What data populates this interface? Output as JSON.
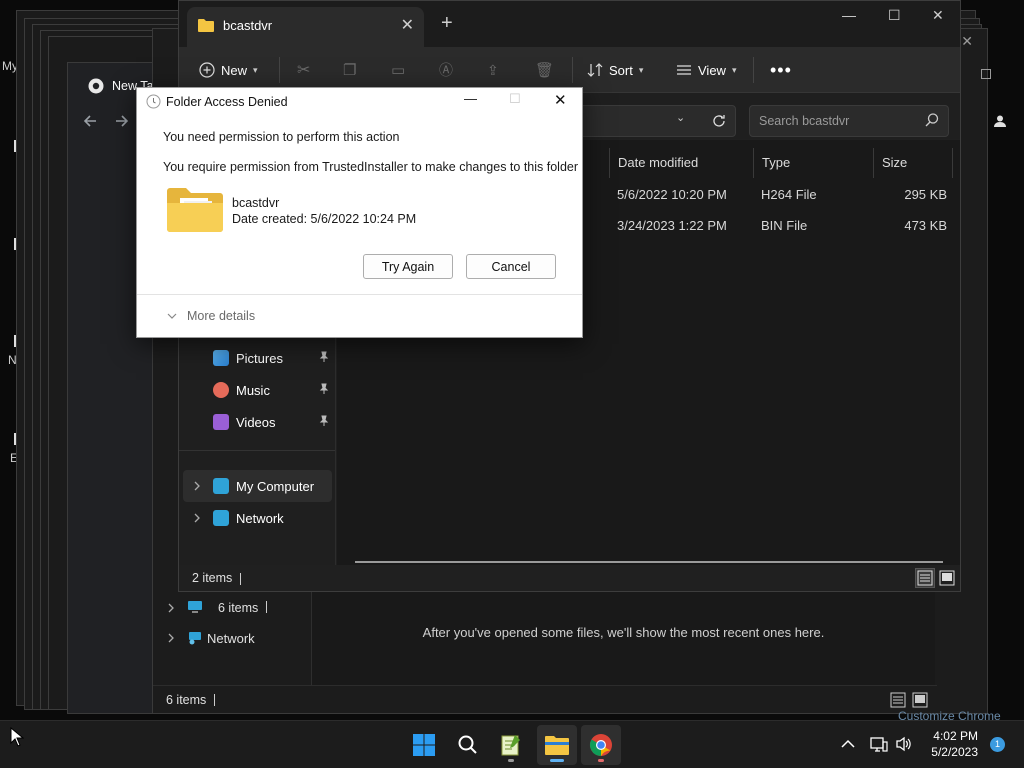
{
  "desktop": {
    "frag_1": "My",
    "frag_2": "N",
    "frag_3": "E"
  },
  "chrome": {
    "tab_title": "New Tab",
    "partial_text": "Customize Chrome"
  },
  "back_explorer": {
    "nav": {
      "my_computer_count_label": "6 items",
      "network_label": "Network"
    },
    "empty_message": "After you've opened some files, we'll show the most recent ones here.",
    "status": "6 items"
  },
  "explorer": {
    "tab_title": "bcastdvr",
    "toolbar": {
      "new_label": "New",
      "sort_label": "Sort",
      "view_label": "View"
    },
    "search_placeholder": "Search bcastdvr",
    "columns": {
      "date": "Date modified",
      "type": "Type",
      "size": "Size"
    },
    "files": [
      {
        "date": "5/6/2022 10:20 PM",
        "type": "H264 File",
        "size": "295 KB"
      },
      {
        "date": "3/24/2023 1:22 PM",
        "type": "BIN File",
        "size": "473 KB"
      }
    ],
    "nav": {
      "pictures": "Pictures",
      "music": "Music",
      "videos": "Videos",
      "my_computer": "My Computer",
      "network": "Network"
    },
    "status": "2 items"
  },
  "dialog": {
    "title": "Folder Access Denied",
    "message_1": "You need permission to perform this action",
    "message_2": "You require permission from TrustedInstaller to make changes to this folder",
    "folder_name": "bcastdvr",
    "folder_date": "Date created: 5/6/2022 10:24 PM",
    "try_again_label": "Try Again",
    "cancel_label": "Cancel",
    "more_details_label": "More details"
  },
  "taskbar": {
    "time": "4:02 PM",
    "date": "5/2/2023",
    "notification_count": "1"
  },
  "colors": {
    "accent": "#0078d4",
    "folder": "#f4c542",
    "chrome_indicator": "#e46b6b"
  }
}
